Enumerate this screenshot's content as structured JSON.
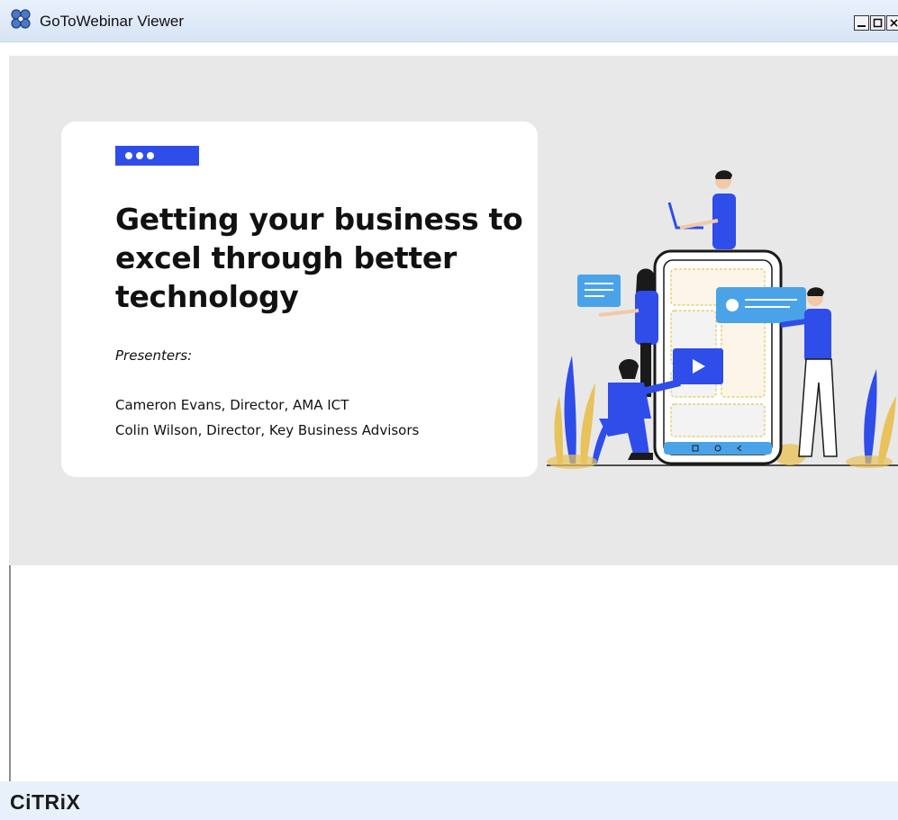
{
  "window": {
    "title": "GoToWebinar Viewer",
    "app_icon": "gotowebinar-flower-icon",
    "buttons": [
      "minimize-icon",
      "maximize-icon",
      "close-icon"
    ]
  },
  "slide": {
    "badge_icon": "three-dots-icon",
    "title": "Getting your business to excel through better technology",
    "presenters_label": "Presenters:",
    "presenters": [
      "Cameron Evans, Director, AMA ICT",
      "Colin Wilson, Director, Key Business Advisors"
    ],
    "illustration": "people-around-smartphone-illustration",
    "colors": {
      "accent": "#2f4de8",
      "card": "#ffffff",
      "background": "#e8e8e8"
    }
  },
  "footer": {
    "logo_text": "CiTRiX"
  }
}
